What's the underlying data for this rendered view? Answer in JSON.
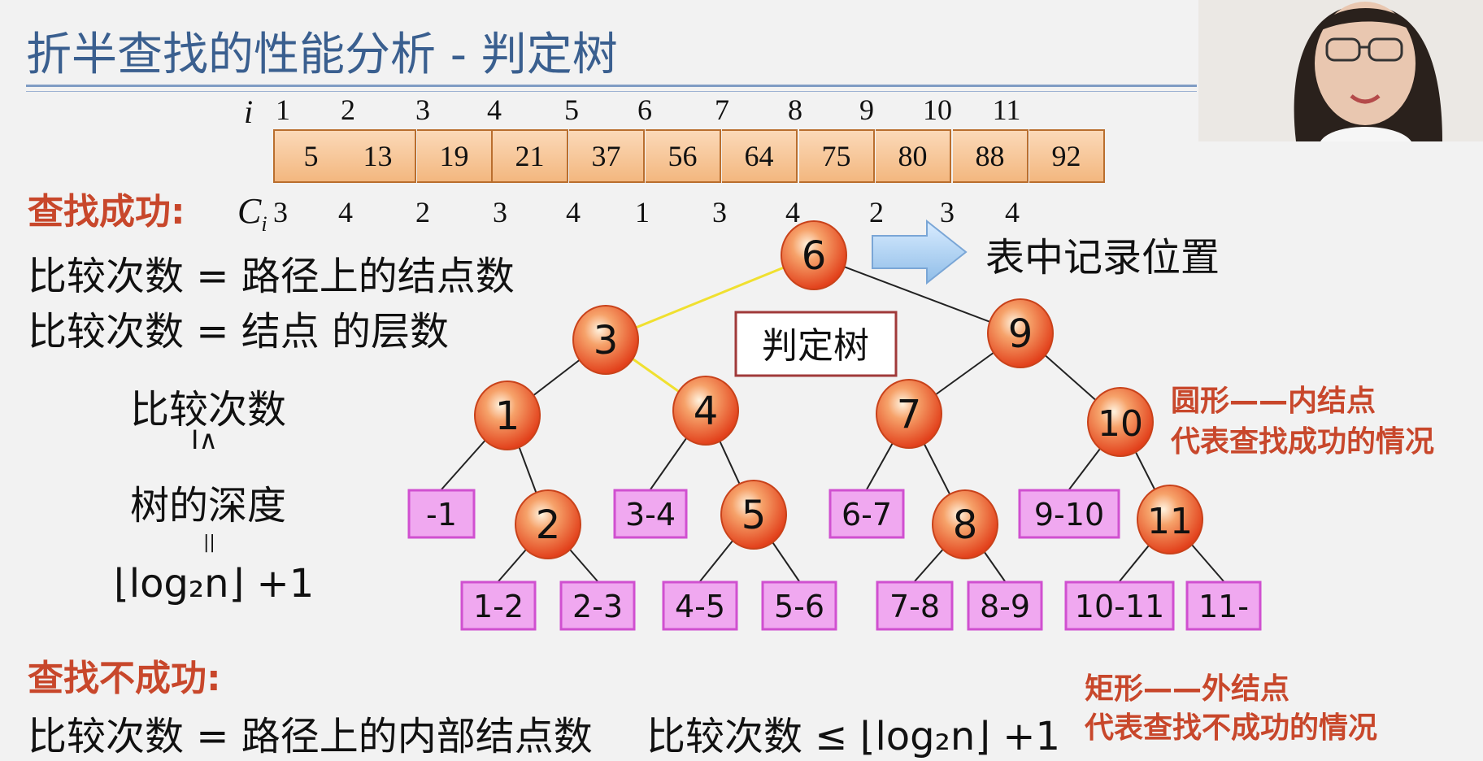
{
  "title": "折半查找的性能分析 - 判定树",
  "table": {
    "i_label": "i",
    "ci_label": "C",
    "ci_sub": "i",
    "indices": [
      "1",
      "2",
      "3",
      "4",
      "5",
      "6",
      "7",
      "8",
      "9",
      "10",
      "11"
    ],
    "values": [
      "5",
      "13",
      "19",
      "21",
      "37",
      "56",
      "64",
      "75",
      "80",
      "88",
      "92"
    ],
    "comparisons": [
      "3",
      "4",
      "2",
      "3",
      "4",
      "1",
      "3",
      "4",
      "2",
      "3",
      "4"
    ]
  },
  "success": {
    "heading": "查找成功:",
    "line1": "比较次数 = 路径上的结点数",
    "line2": "比较次数 = 结点 的层数",
    "stack_top": "比较次数",
    "stack_le": "I∧",
    "stack_mid": "树的深度",
    "stack_eq": "||",
    "formula": "⌊log₂n⌋ +1"
  },
  "failure": {
    "heading": "查找不成功:",
    "line": "比较次数 = 路径上的内部结点数",
    "bound": "比较次数 ≤ ⌊log₂n⌋ +1"
  },
  "tree": {
    "label": "判定树",
    "arrow_text": "表中记录位置",
    "internal_nodes": [
      "6",
      "3",
      "9",
      "1",
      "4",
      "7",
      "10",
      "2",
      "5",
      "8",
      "11"
    ],
    "external_nodes": [
      "-1",
      "3-4",
      "6-7",
      "9-10",
      "1-2",
      "2-3",
      "4-5",
      "5-6",
      "7-8",
      "8-9",
      "10-11",
      "11-"
    ]
  },
  "legend": {
    "circle_line1": "圆形——内结点",
    "circle_line2": "代表查找成功的情况",
    "rect_line1": "矩形——外结点",
    "rect_line2": "代表查找不成功的情况"
  },
  "colors": {
    "title": "#3a5f8f",
    "heading_red": "#c8472b",
    "node_orange": "#e8501e",
    "external_pink": "#f0a8f0",
    "highlight_path": "#f0e030"
  }
}
